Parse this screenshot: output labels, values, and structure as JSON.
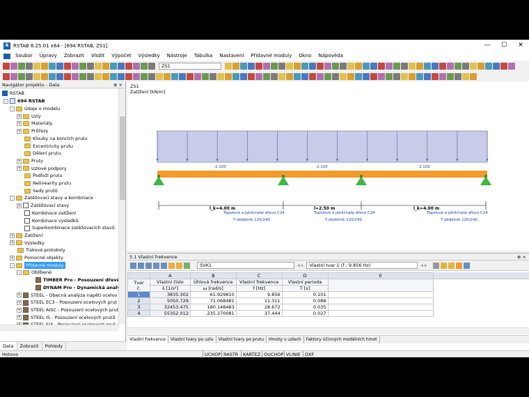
{
  "window": {
    "title": "RSTAB 8.25.01 x64 - [694 RSTAB, ZS1]",
    "min": "—",
    "max": "☐",
    "close": "✕"
  },
  "menu": [
    "Soubor",
    "Úpravy",
    "Zobrazit",
    "Vložit",
    "Výpočet",
    "Výsledky",
    "Nástroje",
    "Tabulka",
    "Nastavení",
    "Přídavné moduly",
    "Okno",
    "Nápověda"
  ],
  "toolbar": {
    "loadcase": "ZS1"
  },
  "navigator": {
    "title": "Navigátor projektu - Data",
    "pin": "⊕ ×",
    "root": "RSTAB",
    "project": "694 RSTAB",
    "items": [
      {
        "t": "Údaje o modelu",
        "lvl": 1,
        "type": "folder",
        "exp": "-"
      },
      {
        "t": "Uzly",
        "lvl": 2,
        "type": "folder",
        "exp": "+"
      },
      {
        "t": "Materiály",
        "lvl": 2,
        "type": "folder",
        "exp": "+"
      },
      {
        "t": "Průřezy",
        "lvl": 2,
        "type": "folder",
        "exp": "+"
      },
      {
        "t": "Klouby na koncích prutu",
        "lvl": 2,
        "type": "folder",
        "exp": ""
      },
      {
        "t": "Excentricity prutu",
        "lvl": 2,
        "type": "folder",
        "exp": ""
      },
      {
        "t": "Dělení prutu",
        "lvl": 2,
        "type": "folder",
        "exp": ""
      },
      {
        "t": "Pruty",
        "lvl": 2,
        "type": "folder",
        "exp": "+"
      },
      {
        "t": "Uzlové podpory",
        "lvl": 2,
        "type": "folder",
        "exp": "+"
      },
      {
        "t": "Podloží prutu",
        "lvl": 2,
        "type": "folder",
        "exp": ""
      },
      {
        "t": "Nelinearity prutu",
        "lvl": 2,
        "type": "folder",
        "exp": ""
      },
      {
        "t": "Sedy prutů",
        "lvl": 2,
        "type": "folder",
        "exp": ""
      },
      {
        "t": "Zatěžovací stavy a kombinace",
        "lvl": 1,
        "type": "folder",
        "exp": "-"
      },
      {
        "t": "Zatěžovací stavy",
        "lvl": 2,
        "type": "doc",
        "exp": "+"
      },
      {
        "t": "Kombinace zatížení",
        "lvl": 2,
        "type": "doc",
        "exp": ""
      },
      {
        "t": "Kombinace výsledků",
        "lvl": 2,
        "type": "doc",
        "exp": ""
      },
      {
        "t": "Superkombinace zatěžovacích stavů",
        "lvl": 2,
        "type": "doc",
        "exp": ""
      },
      {
        "t": "Zatížení",
        "lvl": 1,
        "type": "folder",
        "exp": "+"
      },
      {
        "t": "Výsledky",
        "lvl": 1,
        "type": "folder",
        "exp": "+"
      },
      {
        "t": "Tiskové protokoly",
        "lvl": 1,
        "type": "folder",
        "exp": ""
      },
      {
        "t": "Pomocné objekty",
        "lvl": 1,
        "type": "folder",
        "exp": "+"
      },
      {
        "t": "Přídavné moduly",
        "lvl": 1,
        "type": "folder",
        "exp": "-",
        "selected": true
      },
      {
        "t": "Oblíbené",
        "lvl": 2,
        "type": "folder",
        "exp": "-"
      },
      {
        "t": "TIMBER Pro - Posouzení dřevěný",
        "lvl": 3,
        "type": "mod",
        "exp": "",
        "bold": true
      },
      {
        "t": "DYNAM Pro - Dynamická analýza",
        "lvl": 3,
        "type": "mod",
        "exp": "",
        "bold": true
      },
      {
        "t": "STEEL - Obecná analýza napětí ocelov",
        "lvl": 2,
        "type": "mod",
        "exp": "+"
      },
      {
        "t": "STEEL EC3 - Posouzení ocelových prut",
        "lvl": 2,
        "type": "mod",
        "exp": "+"
      },
      {
        "t": "STEEL AISC - Posouzení ocelových prut",
        "lvl": 2,
        "type": "mod",
        "exp": "+"
      },
      {
        "t": "STEEL IS - Posouzení ocelových prutů",
        "lvl": 2,
        "type": "mod",
        "exp": "+"
      },
      {
        "t": "STEEL SIA - Posouzení ocelových prut",
        "lvl": 2,
        "type": "mod",
        "exp": "+"
      }
    ],
    "tabs": [
      "Data",
      "Zobrazit",
      "Pohledy"
    ]
  },
  "view": {
    "lc": "ZS1",
    "loadlabel": "Zatížení [kN/m]",
    "loads": [
      "2.100",
      "2.100",
      "2.100"
    ],
    "members": [
      {
        "mat": "Topolové a jehličnaté dřevo C24",
        "sec": "T-obdélník 120/240"
      },
      {
        "mat": "Topolové a jehličnaté dřevo C24",
        "sec": "T-obdélník 120/240"
      },
      {
        "mat": "Topolové a jehličnaté dřevo C24",
        "sec": "T-obdélník 120/240"
      }
    ],
    "dims": [
      "l_k=4.00 m",
      "l=2.50 m",
      "l_k=4.00 m"
    ]
  },
  "results": {
    "title": "5.1 Vlastní frekvence",
    "combo1": "SVK1",
    "combo2": "Vlastní tvar 1 (f : 9.856 Hz)",
    "cols": [
      "A",
      "B",
      "C",
      "D",
      "E"
    ],
    "h1": [
      "Tvar",
      "Vlastní číslo",
      "Úhlová frekvence",
      "Vlastní frekvence",
      "Vlastní perioda"
    ],
    "h2": [
      "č.",
      "λ [1/s²]",
      "ω [rad/s]",
      "f [Hz]",
      "T [s]"
    ],
    "rows": [
      [
        "1",
        "3835.302",
        "61.929810",
        "9.856",
        "0.101"
      ],
      [
        "2",
        "5050.729",
        "71.068481",
        "11.311",
        "0.088"
      ],
      [
        "3",
        "32453.475",
        "180.148483",
        "28.672",
        "0.035"
      ],
      [
        "4",
        "55352.012",
        "235.270081",
        "37.444",
        "0.027"
      ]
    ],
    "tabs": [
      "Vlastní frekvence",
      "Vlastní tvary po uzlu",
      "Vlastní tvary po prutu",
      "Hmoty v uzlech",
      "Faktory účinných modálních hmot"
    ]
  },
  "status": {
    "text": "Hotovo",
    "modes": [
      "UCHOP",
      "RASTR",
      "KARTEZ",
      "OUCHOP",
      "VLINIE",
      "DXF"
    ]
  }
}
